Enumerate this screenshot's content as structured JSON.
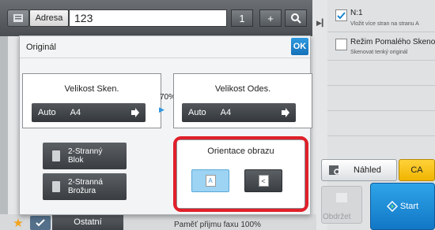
{
  "colors": {
    "accent_blue": "#1a86d0",
    "highlight_red": "#e0202a",
    "ca_yellow": "#f5be00",
    "dark_button": "#3e4246"
  },
  "topbar": {
    "address_tab_label": "Adresa",
    "address_value": "123",
    "counter_label": "1",
    "add_label": "+",
    "search_icon": "magnifier"
  },
  "right_panel": {
    "item1": {
      "title": "N:1",
      "subtitle": "Vložit více stran na stranu A",
      "checked": true
    },
    "item2": {
      "title": "Režim Pomalého Skenování",
      "subtitle": "Skenovat tenký originál",
      "checked": false
    },
    "preview_label": "Náhled",
    "ca_label": "CA",
    "obrzet_label": "Obdržet",
    "start_label": "Start"
  },
  "dialog": {
    "title": "Originál",
    "ok_label": "OK",
    "scan_size": {
      "title": "Velikost Sken.",
      "mode": "Auto",
      "size": "A4"
    },
    "ratio": "70%",
    "send_size": {
      "title": "Velikost Odes.",
      "mode": "Auto",
      "size": "A4"
    },
    "duplex_book": "2-Stranný\nBlok",
    "duplex_tablet": "2-Stranná\nBrožura",
    "orientation": {
      "title": "Orientace obrazu",
      "portrait_glyph": "A",
      "landscape_glyph": "<",
      "selected": "portrait"
    }
  },
  "bottombar": {
    "other_label": "Ostatní",
    "memory_text": "Paměť přijmu faxu   100%"
  }
}
